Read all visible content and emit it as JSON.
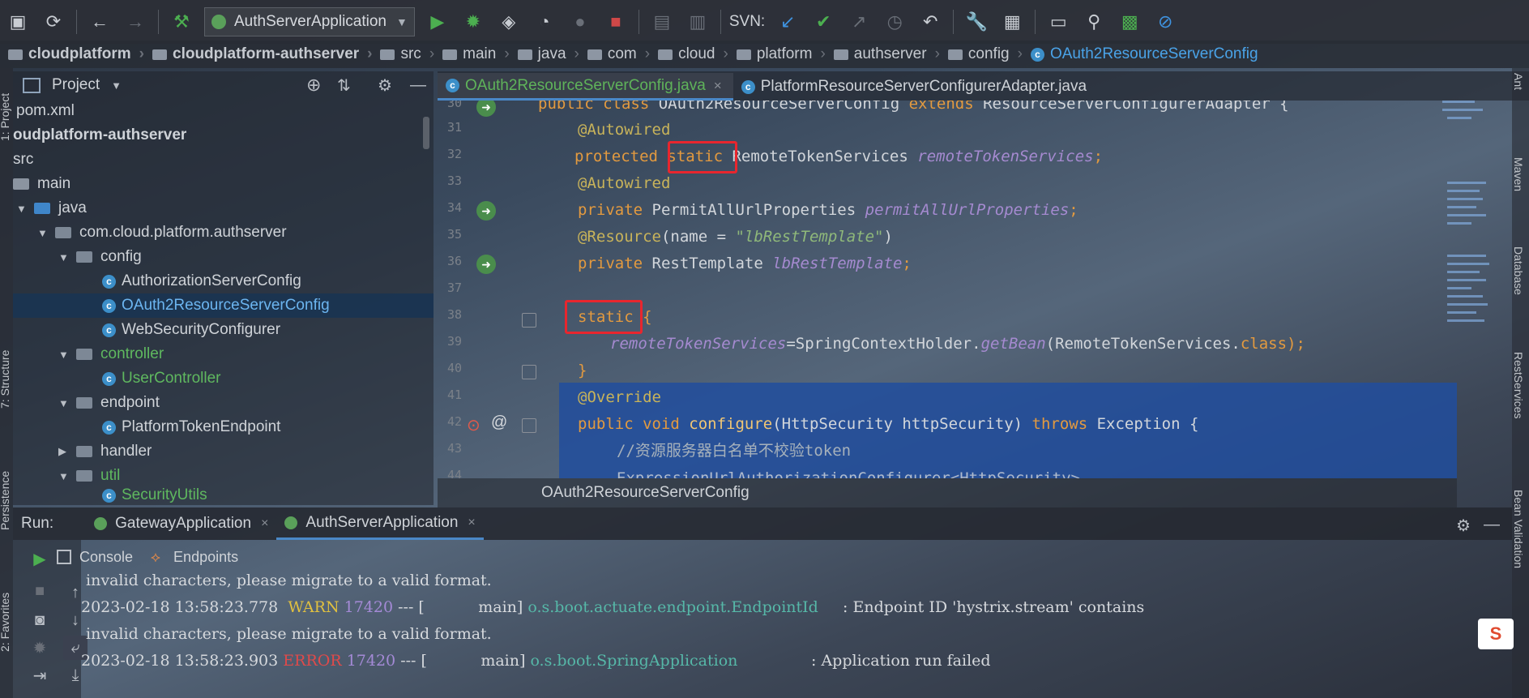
{
  "toolbar": {
    "run_config": "AuthServerApplication",
    "svn_label": "SVN:",
    "icons": [
      "save-all-icon",
      "sync-icon",
      "back-icon",
      "forward-icon",
      "build-hammer-icon",
      "run-icon",
      "debug-icon",
      "coverage-icon",
      "profile-icon",
      "stop-icon",
      "svn-update-icon",
      "svn-commit-icon",
      "svn-compare-icon",
      "history-icon",
      "revert-icon",
      "settings-wrench-icon",
      "project-structure-icon",
      "terminal-icon",
      "search-icon",
      "stats-icon",
      "disable-icon"
    ]
  },
  "breadcrumb": [
    "cloudplatform",
    "cloudplatform-authserver",
    "src",
    "main",
    "java",
    "com",
    "cloud",
    "platform",
    "authserver",
    "config",
    "OAuth2ResourceServerConfig"
  ],
  "side_labels": {
    "left": [
      "1: Project",
      "7: Structure",
      "Persistence",
      "2: Favorites"
    ],
    "right": [
      "Ant",
      "Maven",
      "Database",
      "RestServices",
      "Bean Validation"
    ]
  },
  "project": {
    "title": "Project",
    "tree": [
      {
        "label": "pom.xml",
        "indent": 0
      },
      {
        "label": "oudplatform-authserver",
        "indent": 0,
        "bold": true
      },
      {
        "label": "src",
        "indent": 0
      },
      {
        "label": "main",
        "indent": 0
      },
      {
        "label": "java",
        "indent": 1
      },
      {
        "label": "com.cloud.platform.authserver",
        "indent": 2
      },
      {
        "label": "config",
        "indent": 3
      },
      {
        "label": "AuthorizationServerConfig",
        "indent": 4
      },
      {
        "label": "OAuth2ResourceServerConfig",
        "indent": 4,
        "selected": true
      },
      {
        "label": "WebSecurityConfigurer",
        "indent": 4
      },
      {
        "label": "controller",
        "indent": 3
      },
      {
        "label": "UserController",
        "indent": 4
      },
      {
        "label": "endpoint",
        "indent": 3
      },
      {
        "label": "PlatformTokenEndpoint",
        "indent": 4
      },
      {
        "label": "handler",
        "indent": 3
      },
      {
        "label": "util",
        "indent": 3
      },
      {
        "label": "SecurityUtils",
        "indent": 4
      }
    ]
  },
  "editor": {
    "tabs": [
      {
        "label": "OAuth2ResourceServerConfig.java",
        "active": true
      },
      {
        "label": "PlatformResourceServerConfigurerAdapter.java",
        "active": false
      }
    ],
    "line_numbers": [
      "30",
      "31",
      "32",
      "33",
      "34",
      "35",
      "36",
      "37",
      "38",
      "39",
      "40",
      "41",
      "42",
      "43",
      "44"
    ],
    "lines": {
      "l30": {
        "a": "public class ",
        "b": "OAuth2ResourceServerConfig ",
        "c": "extends ",
        "d": "ResourceServerConfigurerAdapter {"
      },
      "l31": {
        "a": "@Autowired"
      },
      "l32": {
        "a": "protected ",
        "b": "static",
        "c": " RemoteTokenServices ",
        "d": "remoteTokenServices",
        ";": ";"
      },
      "l33": {
        "a": "@Autowired"
      },
      "l34": {
        "a": "private ",
        "b": "PermitAllUrlProperties ",
        "c": "permitAllUrlProperties",
        ";": ";"
      },
      "l35": {
        "a": "@Resource",
        "b": "(name = ",
        "c": "\"lbRestTemplate\"",
        "d": ")"
      },
      "l36": {
        "a": "private ",
        "b": "RestTemplate ",
        "c": "lbRestTemplate",
        ";": ";"
      },
      "l38": {
        "a": "static",
        "b": " {"
      },
      "l39": {
        "a": "remoteTokenServices",
        "b": "=SpringContextHolder.",
        "c": "getBean",
        "d": "(RemoteTokenServices.",
        "e": "class",
        "f": ");"
      },
      "l40": {
        "a": "}"
      },
      "l41": {
        "a": "@Override"
      },
      "l42": {
        "a": "public void ",
        "b": "configure",
        "c": "(HttpSecurity httpSecurity) ",
        "d": "throws ",
        "e": "Exception {"
      },
      "l43": {
        "a": "//资源服务器白名单不校验token"
      },
      "l44": {
        "a": "ExpressionUrlAuthorizationConfigurer<HttpSecurity>"
      }
    },
    "footer": "OAuth2ResourceServerConfig"
  },
  "run": {
    "label": "Run:",
    "tabs": [
      {
        "label": "GatewayApplication",
        "active": false
      },
      {
        "label": "AuthServerApplication",
        "active": true
      }
    ],
    "subtabs": [
      "Console",
      "Endpoints"
    ],
    "console": {
      "l1": " invalid characters, please migrate to a valid format.",
      "l2_time": "2023-02-18 13:58:23.778",
      "l2_level": "WARN",
      "l2_pid": "17420",
      "l2_mid": " --- [           main] ",
      "l2_logger": "o.s.boot.actuate.endpoint.EndpointId",
      "l2_msg": "     : Endpoint ID 'hystrix.stream' contains",
      "l3": " invalid characters, please migrate to a valid format.",
      "l4_time": "2023-02-18 13:58:23.903",
      "l4_level": "ERROR",
      "l4_pid": "17420",
      "l4_mid": " --- [           main] ",
      "l4_logger": "o.s.boot.SpringApplication",
      "l4_msg": "               : Application run failed"
    }
  },
  "colors": {
    "highlight_box": "#e8262e",
    "selection": "#214e9e",
    "keyword": "#e39a3f",
    "annotation": "#c8b35a"
  }
}
